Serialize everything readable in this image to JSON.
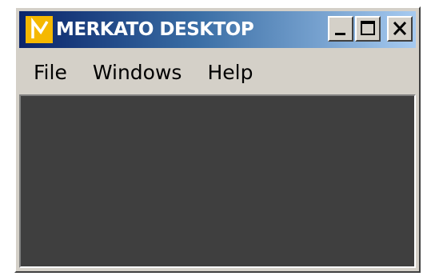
{
  "window": {
    "title": "MERKATO DESKTOP",
    "app_icon": "merkato-logo-icon",
    "controls": {
      "minimize": "minimize-icon",
      "maximize": "maximize-icon",
      "close": "close-icon"
    }
  },
  "menubar": {
    "items": [
      {
        "label": "File"
      },
      {
        "label": "Windows"
      },
      {
        "label": "Help"
      }
    ]
  },
  "colors": {
    "titlebar_start": "#0a246a",
    "titlebar_end": "#a6caf0",
    "app_icon_bg": "#f5b800",
    "window_face": "#d4d0c8",
    "desktop_bg": "#3f3f3f"
  }
}
